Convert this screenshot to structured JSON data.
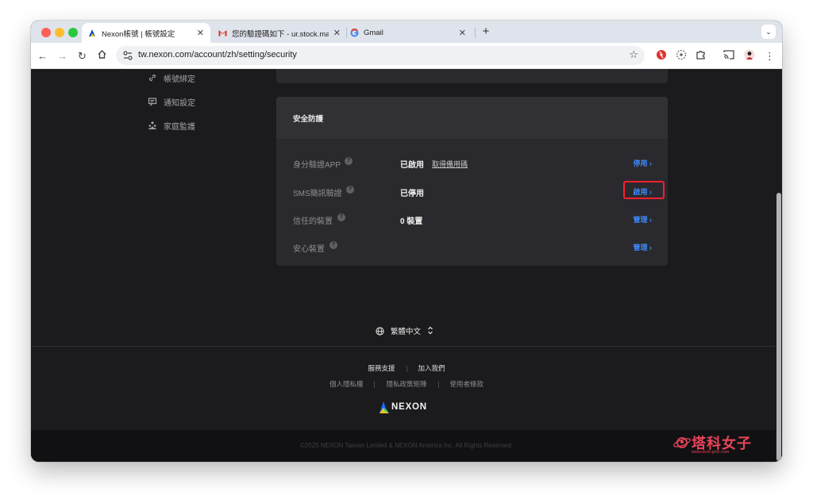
{
  "browser": {
    "tabs": [
      {
        "title": "Nexon帳號 | 帳號設定",
        "close": "✕"
      },
      {
        "title": "您的驗證碼如下 - ur.stock.ma",
        "close": "✕"
      },
      {
        "title": "Gmail",
        "close": "✕"
      }
    ],
    "new_tab": "+",
    "tab_menu": "⌄",
    "url": "tw.nexon.com/account/zh/setting/security"
  },
  "sidebar": {
    "items": [
      {
        "label": "帳號綁定",
        "icon": "link-icon"
      },
      {
        "label": "通知設定",
        "icon": "message-icon"
      },
      {
        "label": "家庭監護",
        "icon": "family-icon"
      }
    ]
  },
  "security": {
    "title": "安全防護",
    "help_glyph": "?",
    "rows": [
      {
        "label": "身分驗證APP",
        "status": "已啟用",
        "sublink": "取得備用碼",
        "action": "停用"
      },
      {
        "label": "SMS簡訊驗證",
        "status": "已停用",
        "sublink": "",
        "action": "啟用"
      },
      {
        "label": "信任的裝置",
        "status": "0 裝置",
        "sublink": "",
        "action": "管理"
      },
      {
        "label": "安心裝置",
        "status": "",
        "sublink": "",
        "action": "管理"
      }
    ],
    "chevron": "›",
    "highlight_color": "#ff1e2e"
  },
  "language": {
    "label": "繁體中文",
    "toggle": "⌃⌄"
  },
  "footer": {
    "links_primary": [
      "服務支援",
      "加入我們"
    ],
    "links_secondary": [
      "個人隱私權",
      "隱私政策矩陣",
      "使用者條款"
    ],
    "logo_text": "NEXON",
    "copyright": "©2025 NEXON Taiwan Limited & NEXON America Inc. All Rights Reserved."
  },
  "watermark": {
    "text": "塔科女子",
    "sub": "www.tech-girlz.com"
  },
  "colors": {
    "page_bg": "#1b1b1d",
    "card_bg": "#2a2a2e",
    "accent_blue": "#3d8bff",
    "watermark_red": "#e9445a"
  }
}
